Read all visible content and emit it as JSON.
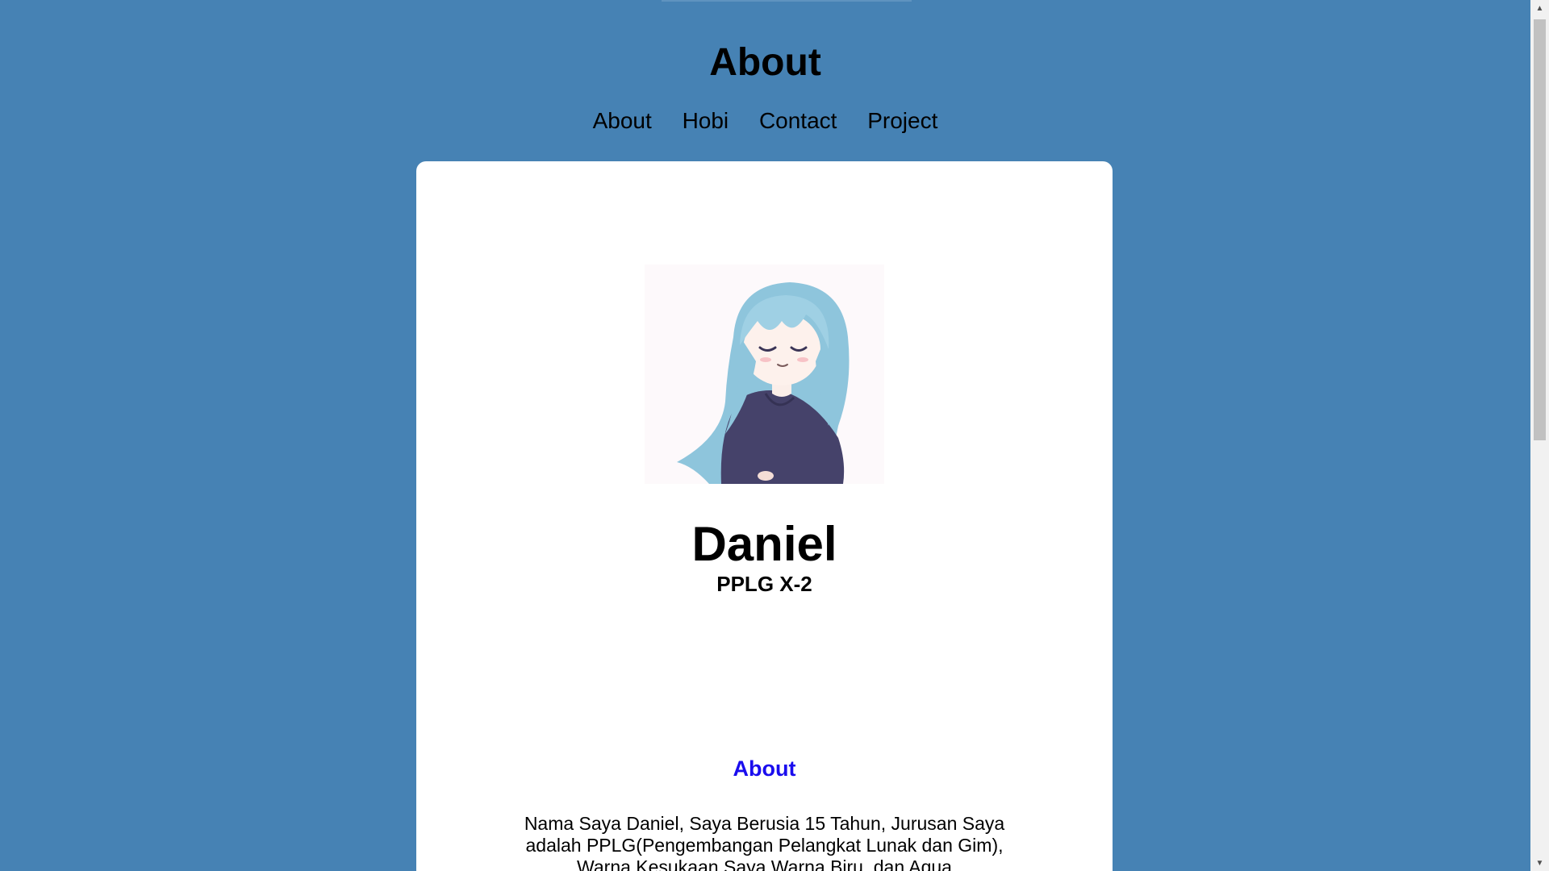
{
  "header": {
    "title": "About"
  },
  "nav": {
    "items": [
      "About",
      "Hobi",
      "Contact",
      "Project"
    ]
  },
  "profile": {
    "name": "Daniel",
    "class": "PPLG X-2"
  },
  "about": {
    "heading": "About",
    "text": "Nama Saya Daniel, Saya Berusia 15 Tahun, Jurusan Saya adalah PPLG(Pengembangan Pelangkat Lunak dan Gim), Warna Kesukaan Saya Warna Biru, dan Aqua"
  },
  "colors": {
    "background": "#4682b4",
    "card": "#ffffff",
    "about_heading": "#1a0dee"
  }
}
